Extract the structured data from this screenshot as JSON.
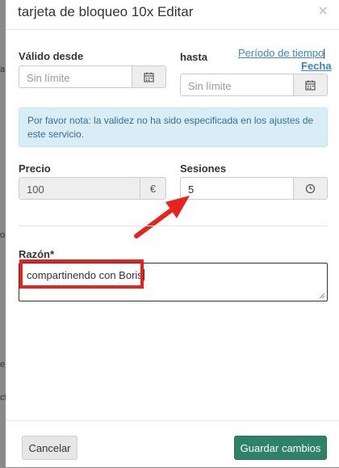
{
  "background": {
    "fragments": [
      "a",
      "o",
      "e",
      "ct"
    ]
  },
  "modal": {
    "title": "tarjeta de bloqueo 10x Editar",
    "close_symbol": "×"
  },
  "validity": {
    "from_label": "Válido desde",
    "from_placeholder": "Sin límite",
    "to_label": "hasta",
    "to_placeholder": "Sin límite",
    "link_period": "Período de tiempo",
    "link_separator": "|",
    "link_date": "Fecha",
    "icon": "calendar-icon"
  },
  "note": {
    "text": "Por favor nota: la validez no ha sido especificada en los ajustes de este servicio."
  },
  "price": {
    "label": "Precio",
    "value": "100",
    "currency": "€"
  },
  "sessions": {
    "label": "Sesiones",
    "value": "5",
    "icon": "clock-icon"
  },
  "reason": {
    "label": "Razón*",
    "value": "compartinendo con Boris"
  },
  "footer": {
    "cancel_label": "Cancelar",
    "save_label": "Guardar cambios"
  },
  "colors": {
    "annotation": "#e8231d",
    "primary": "#2d8267",
    "info_bg": "#d9edf7",
    "link": "#3a86c9"
  }
}
